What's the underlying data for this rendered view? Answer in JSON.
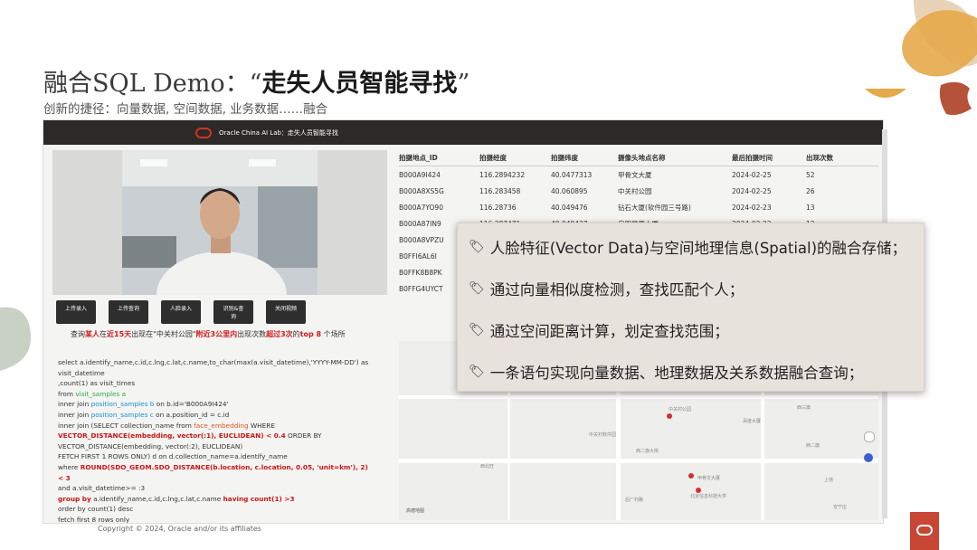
{
  "slide": {
    "title_prefix": "融合SQL Demo：“",
    "title_bold": "走失人员智能寻找",
    "title_suffix": "”",
    "subtitle": "创新的捷径：向量数据, 空间数据, 业务数据……融合",
    "copyright": "Copyright © 2024, Oracle and/or its affiliates"
  },
  "app": {
    "header_title": "Oracle China AI Lab：走失人员智能寻找",
    "buttons": [
      "上传录入",
      "上传查询",
      "人脸录入",
      "识别&查询",
      "关闭视频"
    ],
    "query_text": {
      "p1": "查询",
      "p2": "某人",
      "p3": "在",
      "p4": "近15天",
      "p5": "出现在\"中关村公园\"",
      "p6": "附近3公里内",
      "p7": "出现次数",
      "p8": "超过3次",
      "p9": "的",
      "p10": "top 8",
      "p11": "个场所"
    },
    "sql": {
      "l1": "select a.identify_name,c.id,c.lng,c.lat,c.name,to_char(max(a.visit_datetime),'YYYY-MM-DD') as visit_datetime",
      "l2": ",count(1) as visit_times",
      "l3a": "from ",
      "l3b": "visit_samples a",
      "l4a": "inner join ",
      "l4b": "position_samples b",
      "l4c": " on b.id='B000A9I424'",
      "l5a": "inner join ",
      "l5b": "position_samples c",
      "l5c": " on a.position_id = c.id",
      "l6a": "inner join (SELECT collection_name from ",
      "l6b": "face_embedding",
      "l6c": " WHERE",
      "l7a": "VECTOR_DISTANCE(embedding, vector(:1), EUCLIDEAN) < 0.4",
      "l7b": " ORDER BY",
      "l8": "VECTOR_DISTANCE(embedding, vector(:2), EUCLIDEAN)",
      "l9": "FETCH FIRST 1 ROWS ONLY) d on d.collection_name=a.identify_name",
      "l10a": "where ",
      "l10b": "ROUND(SDO_GEOM.SDO_DISTANCE(b.location, c.location, 0.05, 'unit=km'), 2) < 3",
      "l11": "and a.visit_datetime>= :3",
      "l12a": "group by",
      "l12b": " a.identify_name,c.id,c.lng,c.lat,c.name ",
      "l12c": "having count(1) >3",
      "l13": "order by count(1) desc",
      "l14": "fetch first 8 rows only"
    },
    "table": {
      "headers": [
        "拍摄地点_ID",
        "拍摄经度",
        "拍摄纬度",
        "摄像头地点名称",
        "最后拍摄时间",
        "出现次数"
      ],
      "rows": [
        [
          "B000A9I424",
          "116.2894232",
          "40.0477313",
          "甲骨文大厦",
          "2024-02-25",
          "52"
        ],
        [
          "B000A8XS5G",
          "116.283458",
          "40.060895",
          "中关村公园",
          "2024-02-25",
          "26"
        ],
        [
          "B000A7YO90",
          "116.28736",
          "40.049476",
          "钻石大厦(软件园三号路)",
          "2024-02-23",
          "13"
        ],
        [
          "B000A87IN9",
          "116.287471",
          "40.049437",
          "启明星辰大厦",
          "2024-02-22",
          "12"
        ],
        [
          "B000A8VPZU",
          "",
          "",
          "",
          "",
          ""
        ],
        [
          "B0FFI6AL6I",
          "",
          "",
          "",
          "",
          ""
        ],
        [
          "B0FFK8B8PK",
          "",
          "",
          "",
          "",
          ""
        ],
        [
          "B0FFG4UYCT",
          "",
          "",
          "",
          "",
          ""
        ]
      ]
    },
    "map_labels": {
      "a": "中关村公园",
      "b": "中关村软件园",
      "c": "西二旗大街",
      "d": "甲骨文大厦",
      "e": "北京信息科技大学",
      "f": "西北旺",
      "g": "西二旗",
      "h": "后厂村路",
      "i": "上地",
      "j": "百度大厦",
      "k": "西三旗",
      "l": "安宁庄",
      "m": "高德地图"
    }
  },
  "overlay": {
    "bullets": [
      "人脸特征(Vector Data)与空间地理信息(Spatial)的融合存储；",
      "通过向量相似度检测，查找匹配个人；",
      "通过空间距离计算，划定查找范围；",
      "一条语句实现向量数据、地理数据及关系数据融合查询；"
    ]
  },
  "colors": {
    "brand_red": "#c74634",
    "sql_keyword": "#cc1515",
    "sql_table": "#1d8fd2",
    "overlay_bg": "#e8e2dc",
    "deco_orange": "#e5a84a",
    "deco_beige": "#e9d3b7",
    "deco_rust": "#b4533a",
    "deco_sage": "#b7c2b0"
  },
  "icons": [
    "tag-icon",
    "oracle-logo-icon"
  ]
}
